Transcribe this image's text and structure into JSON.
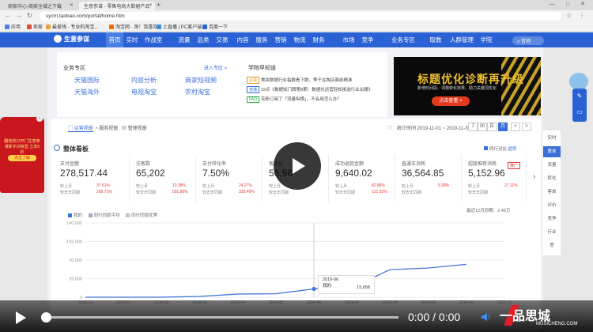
{
  "browser": {
    "tabs": [
      {
        "label": "商家中心-商家全域之下载"
      },
      {
        "label": "生意参谋 - 零售电商大数据产品"
      }
    ],
    "new_tab": "+",
    "window_controls": "— □ ✕",
    "url": "sycm.taobao.com/portal/home.htm",
    "bookmarks": [
      {
        "label": "应用",
        "color": "#4a7fe6"
      },
      {
        "label": "卖家",
        "color": "#e84a3a"
      },
      {
        "label": "最爱钱 - 专业的淘宝...",
        "color": "#e8a23a"
      },
      {
        "label": "淘宝网 - 淘！我喜欢",
        "color": "#ff6a00"
      },
      {
        "label": "上直播 | PC客户端",
        "color": "#3a8ce8"
      },
      {
        "label": "百度一下",
        "color": "#2a62d6"
      }
    ]
  },
  "topnav": {
    "brand": "生意参谋",
    "items": [
      "首页",
      "实时",
      "作战室",
      "流量",
      "品类",
      "交易",
      "内容",
      "服务",
      "营销",
      "物流",
      "财务",
      "市场",
      "竞争",
      "业务专区",
      "取数",
      "人群管理",
      "学院"
    ],
    "active": "首页",
    "search": "咨询"
  },
  "business": {
    "title": "业务专区",
    "more": "进入专区 >",
    "items": [
      "天猫国际",
      "内容分析",
      "商家短视频",
      "天猫海外",
      "电视淘宝",
      "农村淘宝"
    ]
  },
  "learn": {
    "title": "学院早知道",
    "items": [
      {
        "tag": "必看",
        "text": "美妆数据行业指数看下数，等于在掏店面前精准"
      },
      {
        "tag": "直播",
        "text": "15点《数据知门牌第8期：数据化运营轻松挑选行业出摆》"
      },
      {
        "tag": "FAQ",
        "text": "花粉订阅了「流量纵横」，不会用怎么办？"
      }
    ]
  },
  "banner": {
    "title": "标题优化诊断再升级",
    "subtitle": "新增时间段、词根转化效果，助力关键词优化",
    "button": "点击查看 >"
  },
  "dashboard": {
    "tabs": [
      "运营视窗",
      "服务视窗",
      "管理视窗"
    ],
    "active_tab": "运营视窗",
    "date_range": "统计时间 2019-11-01 ~ 2019-11-30",
    "period_buttons": [
      "7",
      "30",
      "日",
      "周",
      "月",
      "<",
      ">"
    ],
    "active_period": "月",
    "overview_title": "整体看板",
    "compare_label": "同行对比",
    "compare_link": "趋势",
    "trend_label": "最近12月同期：2.46万",
    "ad_badge": "推广",
    "metrics": [
      {
        "label": "支付金额",
        "value": "278,517.44",
        "mom_label": "较上月",
        "mom": "37.51%",
        "mom_dir": "up",
        "yoy_label": "较去年同期",
        "yoy": "268.71%",
        "yoy_dir": "up"
      },
      {
        "label": "访客数",
        "value": "65,202",
        "mom_label": "较上月",
        "mom": "13.38%",
        "mom_dir": "up",
        "yoy_label": "较去年同期",
        "yoy": "591.80%",
        "yoy_dir": "up"
      },
      {
        "label": "支付转化率",
        "value": "7.50%",
        "mom_label": "较上月",
        "mom": "24.27%",
        "mom_dir": "up",
        "yoy_label": "较去年同期",
        "yoy": "328.49%",
        "yoy_dir": "up"
      },
      {
        "label": "客单价",
        "value": "56.96",
        "mom_label": "较上月",
        "mom": "",
        "mom_dir": "down",
        "yoy_label": "较去年同期",
        "yoy": "",
        "yoy_dir": "down"
      },
      {
        "label": "成功退款金额",
        "value": "9,640.02",
        "mom_label": "较上月",
        "mom": "82.86%",
        "mom_dir": "up",
        "yoy_label": "较去年同期",
        "yoy": "121.92%",
        "yoy_dir": "up"
      },
      {
        "label": "直通车消耗",
        "value": "36,564.85",
        "mom_label": "较上月",
        "mom": "6.38%",
        "mom_dir": "up",
        "yoy_label": "较去年同期",
        "yoy": "",
        "yoy_dir": "up"
      },
      {
        "label": "超级推荐消耗",
        "value": "5,152.96",
        "mom_label": "较上月",
        "mom": "27.11%",
        "mom_dir": "up",
        "yoy_label": "较去年同期",
        "yoy": "",
        "yoy_dir": "up"
      }
    ]
  },
  "chart_data": {
    "type": "line",
    "series": [
      {
        "name": "我的",
        "color": "#3a6fd8",
        "values": [
          0,
          0,
          0,
          1500,
          6000,
          6500,
          15658,
          19000,
          52000,
          55000,
          62000
        ]
      },
      {
        "name": "同行同层平均",
        "color": "#9aa8c0",
        "values": []
      },
      {
        "name": "同行同层优秀",
        "color": "#b9c3d6",
        "values": []
      }
    ],
    "y_ticks": [
      "0",
      "35,000",
      "70,000",
      "105,000",
      "140,000"
    ],
    "ylim": [
      0,
      140000
    ],
    "x_ticks": [
      "2018-12",
      "2019-01",
      "2019-02",
      "2019-03",
      "2019-04",
      "2019-05",
      "2019-06",
      "2019-07",
      "2019-08",
      "2019-09",
      "2019-10",
      "2019-11"
    ],
    "tooltip": {
      "date": "2019-06",
      "name": "我的",
      "value": "15,658"
    },
    "grid": true
  },
  "left_ad": {
    "text": "翻倍双12开门生意参谋新手训练营 立享9折",
    "button": "点击了解"
  },
  "right_bar": [
    "实时",
    "整体",
    "流量",
    "转化",
    "客单",
    "评价",
    "竞争",
    "行业",
    "思"
  ],
  "right_bar_active": "整体",
  "video": {
    "time": "0:00 / 0:00",
    "logo": "一品思城",
    "logo_sub": "MUSICHENG.COM"
  }
}
